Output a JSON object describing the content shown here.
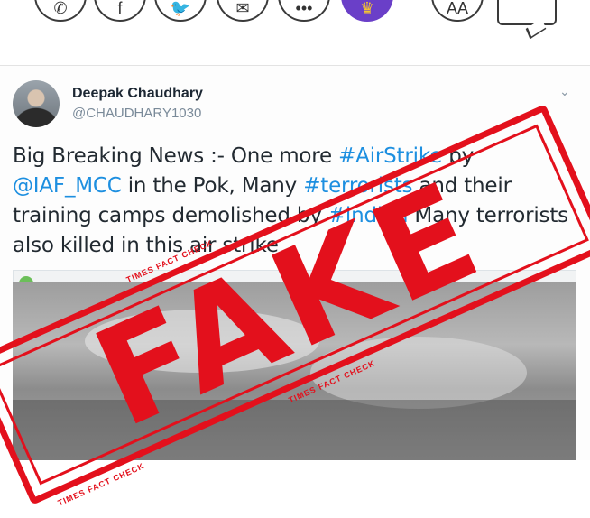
{
  "share_bar": {
    "buttons": [
      {
        "name": "whatsapp-button",
        "icon": "whatsapp-icon",
        "glyph": "✆"
      },
      {
        "name": "facebook-button",
        "icon": "facebook-icon",
        "glyph": "f"
      },
      {
        "name": "twitter-button",
        "icon": "twitter-icon",
        "glyph": "🐦"
      },
      {
        "name": "email-button",
        "icon": "mail-icon",
        "glyph": "✉"
      },
      {
        "name": "more-button",
        "icon": "more-icon",
        "glyph": "•••"
      },
      {
        "name": "premium-button",
        "icon": "crown-icon",
        "glyph": "♛"
      }
    ],
    "text_size_label": "AA"
  },
  "tweet": {
    "author_name": "Deepak Chaudhary",
    "author_handle": "@CHAUDHARY1030",
    "text_parts": [
      {
        "t": "Big Breaking News :- One more ",
        "hl": false
      },
      {
        "t": "#AirStrike",
        "hl": true
      },
      {
        "t": " by ",
        "hl": false
      },
      {
        "t": "@IAF_MCC",
        "hl": true
      },
      {
        "t": " in the Pok, Many ",
        "hl": false
      },
      {
        "t": "#terrorists",
        "hl": true
      },
      {
        "t": " and their training camps demolished by ",
        "hl": false
      },
      {
        "t": "#indian",
        "hl": true
      },
      {
        "t": " Many terrorists also killed in this air strike",
        "hl": false
      }
    ],
    "menu_icon": "chevron-down-icon"
  },
  "stamp": {
    "word": "FAKE",
    "caption": "TIMES FACT CHECK",
    "color": "#e3101c"
  },
  "colors": {
    "link": "#1d8fe0",
    "premium": "#6a3fc8"
  }
}
